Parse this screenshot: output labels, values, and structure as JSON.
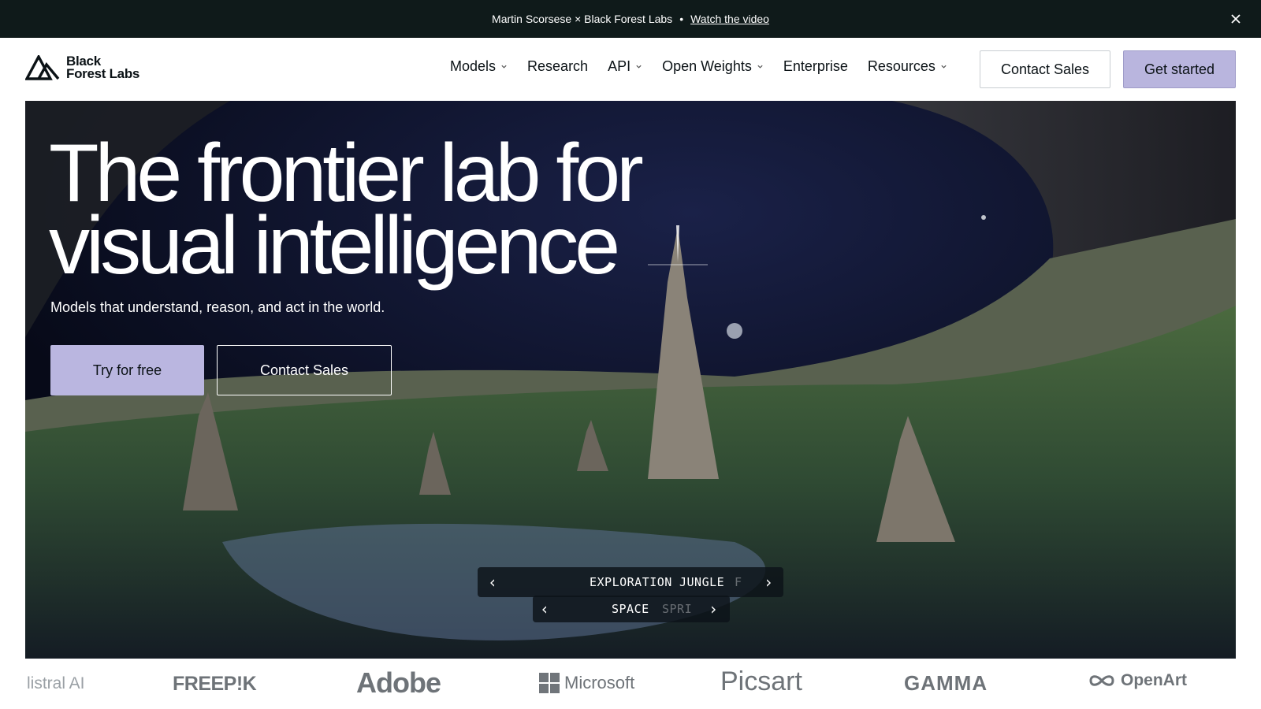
{
  "announcement": {
    "text": "Martin Scorsese × Black Forest Labs",
    "separator": "•",
    "link": "Watch the video"
  },
  "brand": {
    "line1": "Black",
    "line2": "Forest Labs"
  },
  "nav": {
    "items": [
      {
        "label": "Models",
        "dropdown": true
      },
      {
        "label": "Research",
        "dropdown": false
      },
      {
        "label": "API",
        "dropdown": true
      },
      {
        "label": "Open Weights",
        "dropdown": true
      },
      {
        "label": "Enterprise",
        "dropdown": false
      },
      {
        "label": "Resources",
        "dropdown": true
      }
    ],
    "contact_label": "Contact Sales",
    "cta_label": "Get started"
  },
  "hero": {
    "title_line1": "The frontier lab for",
    "title_line2": "visual intelligence",
    "subtitle": "Models that understand, reason, and act in the world.",
    "primary_label": "Try for free",
    "secondary_label": "Contact Sales"
  },
  "carousel": {
    "row1": [
      "EXPLORATION",
      "JUNGLE",
      "F"
    ],
    "row2": [
      "SPACE",
      "SPRI"
    ]
  },
  "partners": [
    "listral AI",
    "FREEP!K",
    "Adobe",
    "Microsoft",
    "Picsart",
    "GAMMA",
    "OpenArt"
  ],
  "colors": {
    "accent": "#b9b5de",
    "announcement_bg": "#0f1a1a"
  }
}
